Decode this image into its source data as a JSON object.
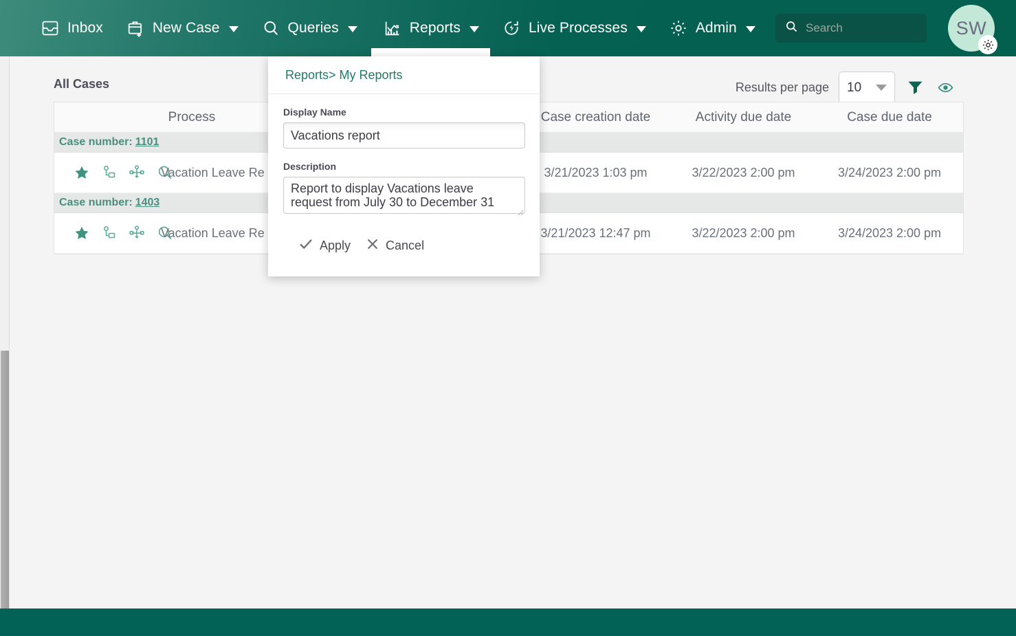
{
  "nav": {
    "items": [
      {
        "label": "Inbox",
        "icon": "inbox-icon",
        "caret": false,
        "active": false
      },
      {
        "label": "New Case",
        "icon": "briefcase-plus-icon",
        "caret": true,
        "active": false
      },
      {
        "label": "Queries",
        "icon": "magnifier-icon",
        "caret": true,
        "active": false
      },
      {
        "label": "Reports",
        "icon": "bar-chart-icon",
        "caret": true,
        "active": true
      },
      {
        "label": "Live Processes",
        "icon": "live-process-icon",
        "caret": true,
        "active": false
      },
      {
        "label": "Admin",
        "icon": "gear-icon",
        "caret": true,
        "active": false
      }
    ],
    "search": {
      "value": "",
      "placeholder": "Search",
      "icon": "search-icon"
    },
    "avatar": {
      "initials": "SW",
      "badge_icon": "gear-icon"
    }
  },
  "toolbar": {
    "page_title": "All Cases",
    "results_per_page_label": "Results per page",
    "results_per_page_value": "10",
    "filter_icon": "filter-icon",
    "visibility_icon": "eye-icon"
  },
  "table": {
    "columns": [
      "Process",
      "",
      "Case creation date",
      "Activity due date",
      "Case due date"
    ],
    "column_header_partial": "se creation date",
    "group_label": "Case number:",
    "row_icons": [
      "star-icon",
      "pin-link-icon",
      "workflow-icon",
      "magnifier-icon"
    ],
    "groups": [
      {
        "case_number": "1101",
        "row": {
          "process": "Vacation Leave Re",
          "spacer": "",
          "creation_date": "3/21/2023 1:03 pm",
          "activity_due_date": "3/22/2023 2:00 pm",
          "case_due_date": "3/24/2023 2:00 pm"
        }
      },
      {
        "case_number": "1403",
        "row": {
          "process": "Vacation Leave Re",
          "spacer": "",
          "creation_date": "3/21/2023 12:47 pm",
          "activity_due_date": "3/22/2023 2:00 pm",
          "case_due_date": "3/24/2023 2:00 pm"
        }
      }
    ]
  },
  "dialog": {
    "breadcrumb": "Reports> My Reports",
    "display_name_label": "Display Name",
    "display_name_value": "Vacations report",
    "description_label": "Description",
    "description_value": "Report to display Vacations leave request from July 30 to December 31",
    "apply_label": "Apply",
    "cancel_label": "Cancel",
    "apply_icon": "check-icon",
    "cancel_icon": "close-x-icon"
  },
  "colors": {
    "header_dark": "#03604f",
    "header_light": "#3d8b7b",
    "accent_teal": "#1f7a68",
    "row_icon_teal": "#4a9e8c",
    "group_text": "#4a8f7d",
    "footer": "#026255",
    "page_bg": "#f4f4f4",
    "avatar_bg": "#c4e8d8"
  }
}
